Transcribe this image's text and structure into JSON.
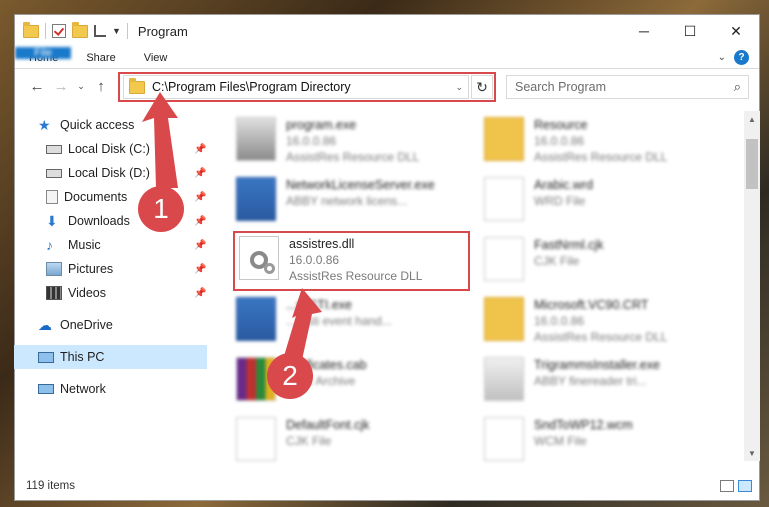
{
  "window": {
    "title": "Program"
  },
  "ribbon": {
    "tabs": [
      "File",
      "Home",
      "Share",
      "View"
    ]
  },
  "address": {
    "path": "C:\\Program Files\\Program Directory"
  },
  "search": {
    "placeholder": "Search Program"
  },
  "sidebar": {
    "items": [
      {
        "label": "Quick access",
        "icon": "star-icon"
      },
      {
        "label": "Local Disk (C:)",
        "icon": "drive-icon",
        "pinned": true
      },
      {
        "label": "Local Disk (D:)",
        "icon": "drive-icon",
        "pinned": true
      },
      {
        "label": "Documents",
        "icon": "documents-icon",
        "pinned": true
      },
      {
        "label": "Downloads",
        "icon": "downloads-icon",
        "pinned": true
      },
      {
        "label": "Music",
        "icon": "music-icon",
        "pinned": true
      },
      {
        "label": "Pictures",
        "icon": "pictures-icon",
        "pinned": true
      },
      {
        "label": "Videos",
        "icon": "videos-icon",
        "pinned": true
      },
      {
        "label": "OneDrive",
        "icon": "cloud-icon"
      },
      {
        "label": "This PC",
        "icon": "computer-icon",
        "selected": true
      },
      {
        "label": "Network",
        "icon": "network-icon"
      }
    ]
  },
  "files": [
    {
      "name": "program.exe",
      "line2": "16.0.0.86",
      "line3": "AssistRes Resource DLL"
    },
    {
      "name": "Resource",
      "line2": "16.0.0.86",
      "line3": "AssistRes Resource DLL"
    },
    {
      "name": "NetworkLicenseServer.exe",
      "line2": "ABBY network licens...",
      "line3": ""
    },
    {
      "name": "Arabic.wrd",
      "line2": "WRD File",
      "line3": ""
    },
    {
      "name": "assistres.dll",
      "line2": "16.0.0.86",
      "line3": "AssistRes Resource DLL"
    },
    {
      "name": "FastNrml.cjk",
      "line2": "CJK File",
      "line3": ""
    },
    {
      "name": "...yySTI.exe",
      "line2": "...Y sti event hand...",
      "line3": ""
    },
    {
      "name": "Microsoft.VC90.CRT",
      "line2": "16.0.0.86",
      "line3": "AssistRes Resource DLL"
    },
    {
      "name": "...rtificates.cab",
      "line2": "...AR Archive",
      "line3": ""
    },
    {
      "name": "TrigrammsInstaller.exe",
      "line2": "ABBY finereader tri...",
      "line3": ""
    },
    {
      "name": "DefaultFont.cjk",
      "line2": "CJK File",
      "line3": ""
    },
    {
      "name": "SndToWP12.wcm",
      "line2": "WCM File",
      "line3": ""
    }
  ],
  "status": {
    "item_count": "119 items"
  },
  "annotations": {
    "step1": "1",
    "step2": "2"
  },
  "colors": {
    "accent": "#1979ca",
    "highlight": "#d9484b",
    "selected": "#cce8ff"
  }
}
